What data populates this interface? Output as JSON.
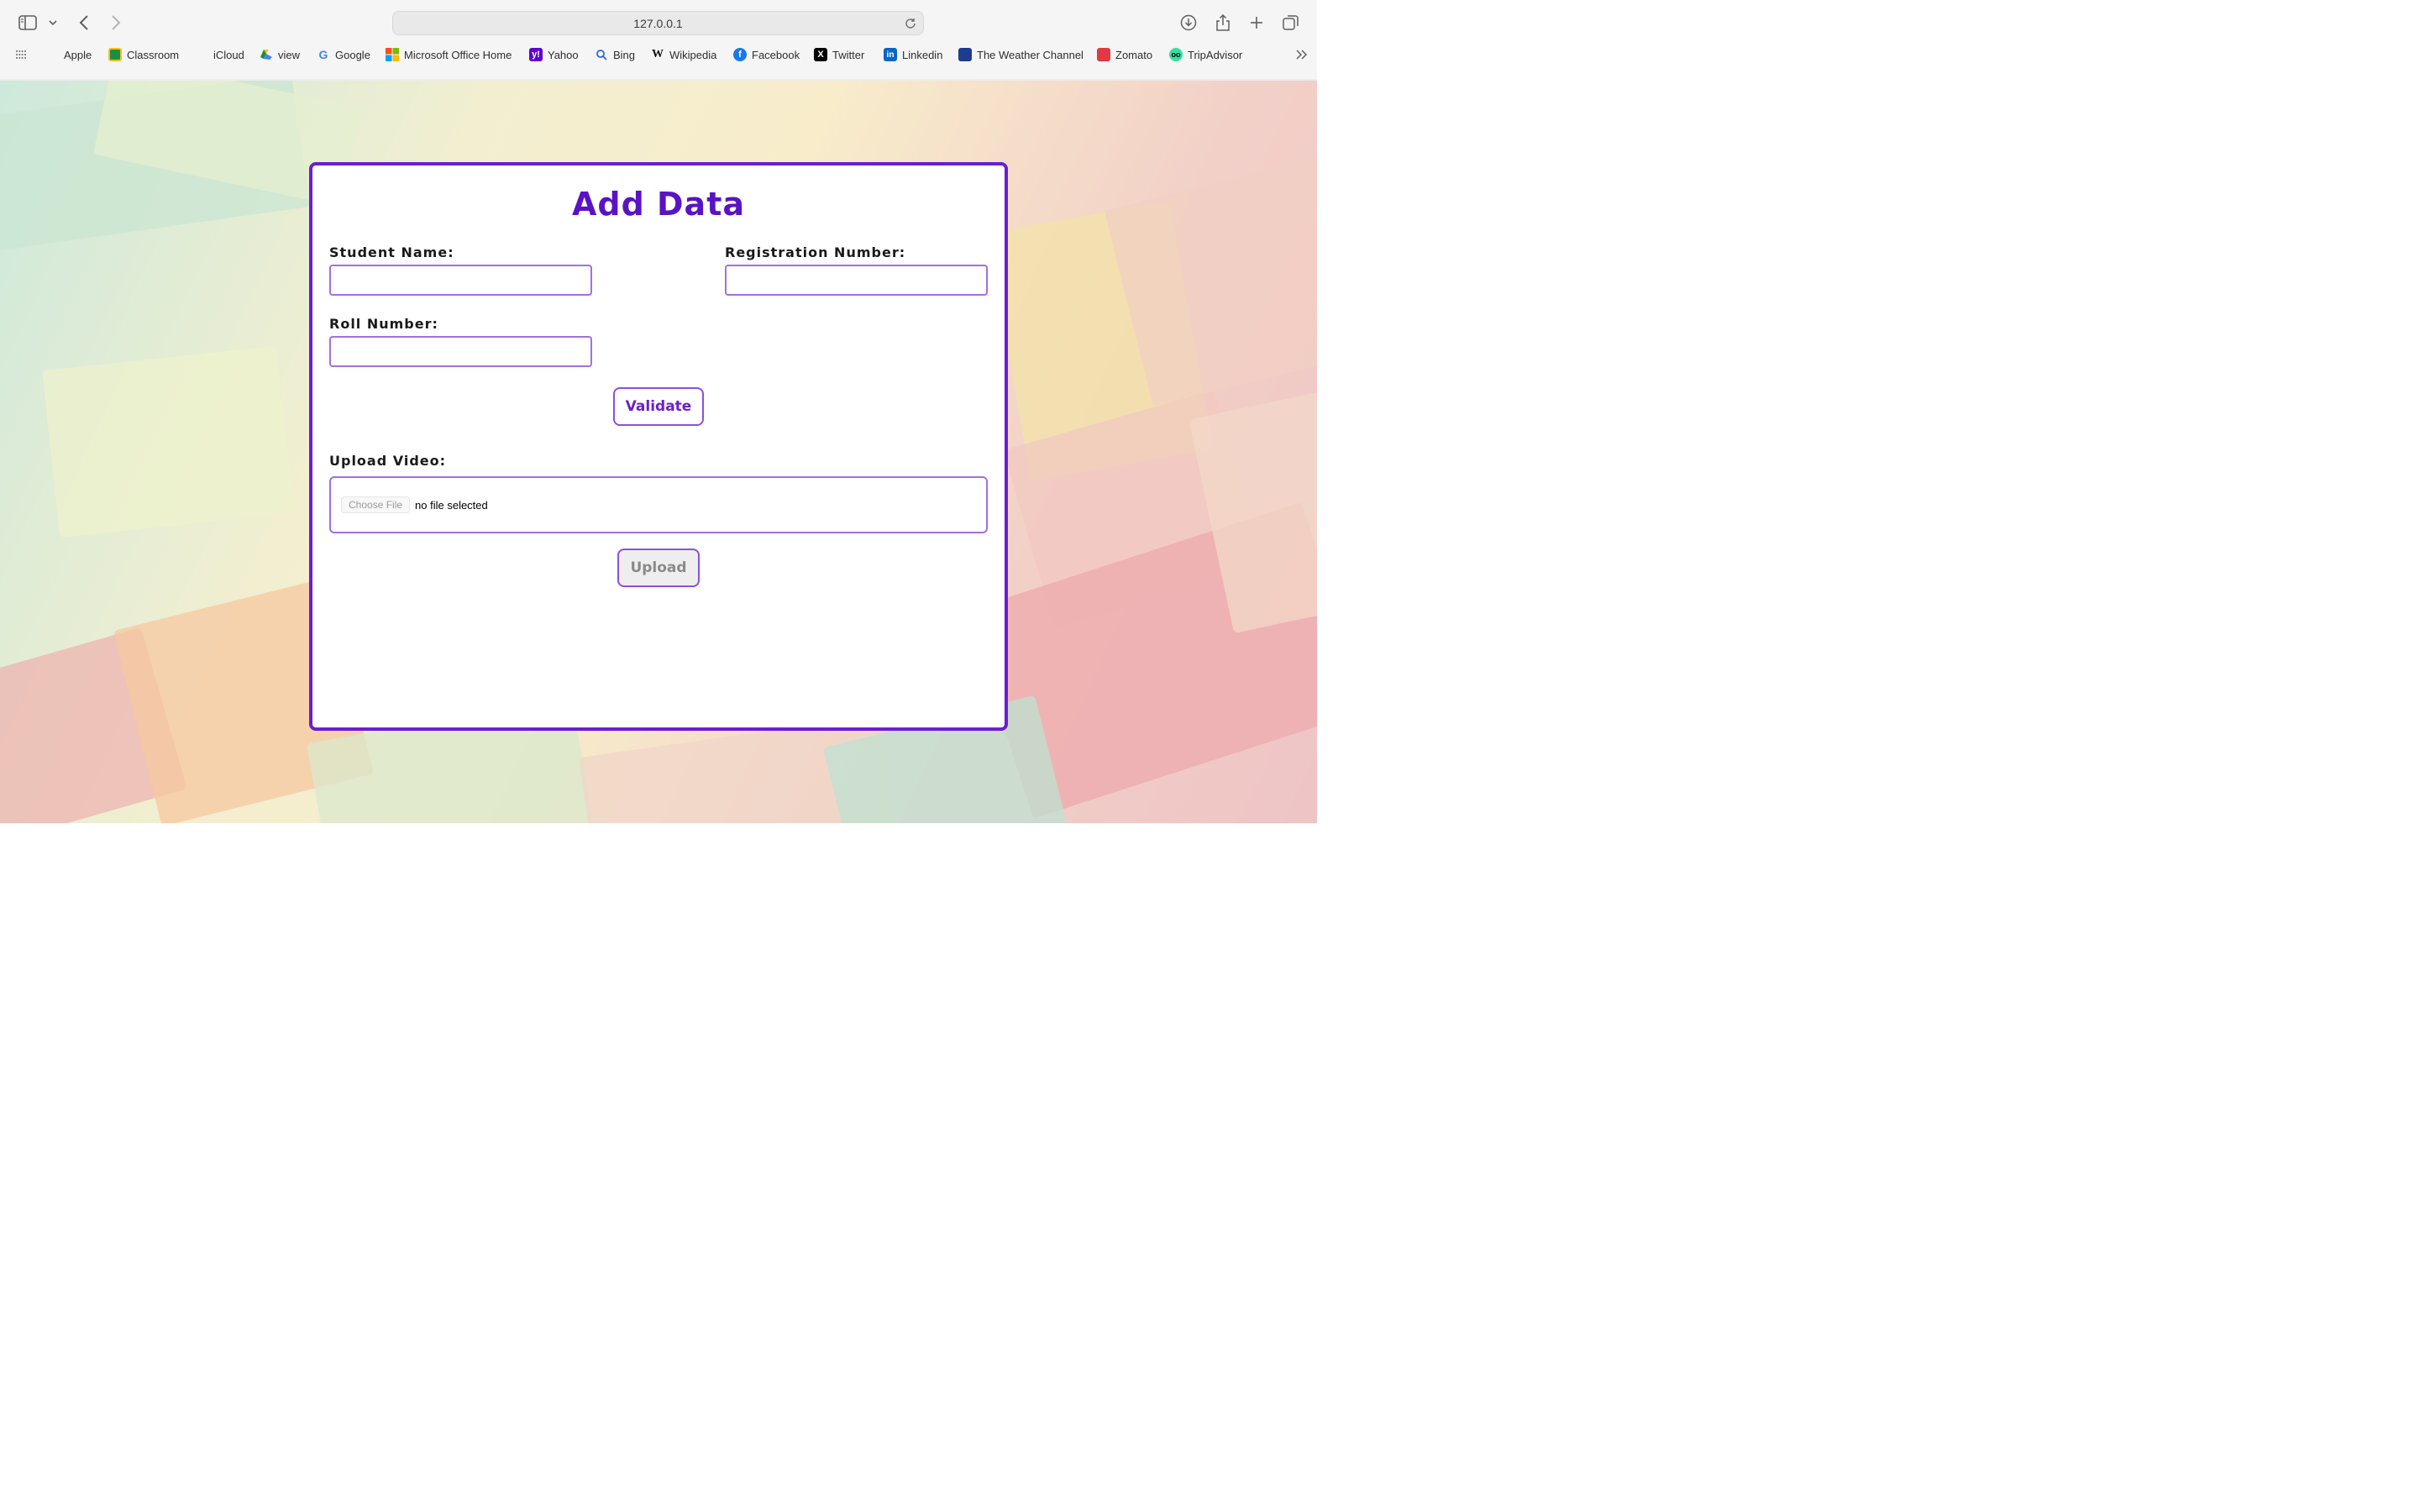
{
  "browser": {
    "url": "127.0.0.1",
    "bookmarks": [
      {
        "label": "Apple",
        "icon": "apple-icon"
      },
      {
        "label": "Classroom",
        "icon": "classroom-icon"
      },
      {
        "label": "iCloud",
        "icon": "icloud-icon"
      },
      {
        "label": "view",
        "icon": "drive-icon"
      },
      {
        "label": "Google",
        "icon": "google-icon"
      },
      {
        "label": "Microsoft Office Home",
        "icon": "microsoft-icon"
      },
      {
        "label": "Yahoo",
        "icon": "yahoo-icon"
      },
      {
        "label": "Bing",
        "icon": "bing-icon"
      },
      {
        "label": "Wikipedia",
        "icon": "wikipedia-icon"
      },
      {
        "label": "Facebook",
        "icon": "facebook-icon"
      },
      {
        "label": "Twitter",
        "icon": "twitter-icon"
      },
      {
        "label": "Linkedin",
        "icon": "linkedin-icon"
      },
      {
        "label": "The Weather Channel",
        "icon": "weather-channel-icon"
      },
      {
        "label": "Zomato",
        "icon": "zomato-icon"
      },
      {
        "label": "TripAdvisor",
        "icon": "tripadvisor-icon"
      }
    ]
  },
  "form": {
    "title": "Add Data",
    "student_name_label": "Student Name:",
    "student_name_value": "",
    "registration_number_label": "Registration Number:",
    "registration_number_value": "",
    "roll_number_label": "Roll Number:",
    "roll_number_value": "",
    "validate_label": "Validate",
    "upload_video_label": "Upload Video:",
    "choose_file_label": "Choose File",
    "file_status": "no file selected",
    "upload_label": "Upload"
  },
  "colors": {
    "accent": "#6a1fd0",
    "title": "#5a13c4",
    "input_border": "#a36fe0"
  }
}
